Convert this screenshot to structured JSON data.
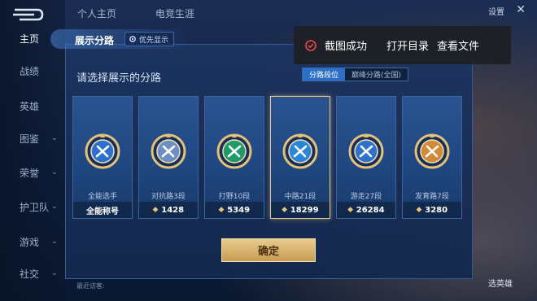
{
  "nav": {
    "items": [
      {
        "label": "主页",
        "active": true,
        "chevron": false
      },
      {
        "label": "战绩",
        "active": false,
        "chevron": false
      },
      {
        "label": "英雄",
        "active": false,
        "chevron": false
      },
      {
        "label": "图鉴",
        "active": false,
        "chevron": true
      },
      {
        "label": "荣誉",
        "active": false,
        "chevron": true
      },
      {
        "label": "护卫队",
        "active": false,
        "chevron": true
      },
      {
        "label": "游戏",
        "active": false,
        "chevron": true
      },
      {
        "label": "社交",
        "active": false,
        "chevron": true
      }
    ]
  },
  "top_tabs": [
    "个人主页",
    "电竞生涯"
  ],
  "top_right": {
    "settings": "设置"
  },
  "modal": {
    "title": "展示分路",
    "priority_label": "优先显示",
    "subtitle": "请选择展示的分路",
    "segments": [
      {
        "label": "分路段位",
        "active": true
      },
      {
        "label": "巅峰分路(全国)",
        "active": false
      }
    ],
    "confirm_label": "确定",
    "cards": [
      {
        "name": "全能选手",
        "footer": "全能称号",
        "has_chevron": false,
        "selected": false,
        "badge_color": "#2c6fcf",
        "icon": "all-round-badge-icon"
      },
      {
        "name": "对抗路3段",
        "footer": "1428",
        "has_chevron": true,
        "selected": false,
        "badge_color": "#6d8fc2",
        "icon": "clash-lane-badge-icon"
      },
      {
        "name": "打野10段",
        "footer": "5349",
        "has_chevron": true,
        "selected": false,
        "badge_color": "#1f9a6a",
        "icon": "jungle-badge-icon"
      },
      {
        "name": "中路21段",
        "footer": "18299",
        "has_chevron": true,
        "selected": true,
        "badge_color": "#2a86d8",
        "icon": "mid-lane-badge-icon"
      },
      {
        "name": "游走27段",
        "footer": "26284",
        "has_chevron": true,
        "selected": false,
        "badge_color": "#2f72c9",
        "icon": "roam-badge-icon"
      },
      {
        "name": "发育路7段",
        "footer": "3280",
        "has_chevron": true,
        "selected": false,
        "badge_color": "#d08a3a",
        "icon": "farm-lane-badge-icon"
      }
    ]
  },
  "toast": {
    "message": "截图成功",
    "open_dir": "打开目录",
    "view_file": "查看文件"
  },
  "footer": {
    "recent_visitors": "最近访客:",
    "right_label": "选英雄"
  }
}
